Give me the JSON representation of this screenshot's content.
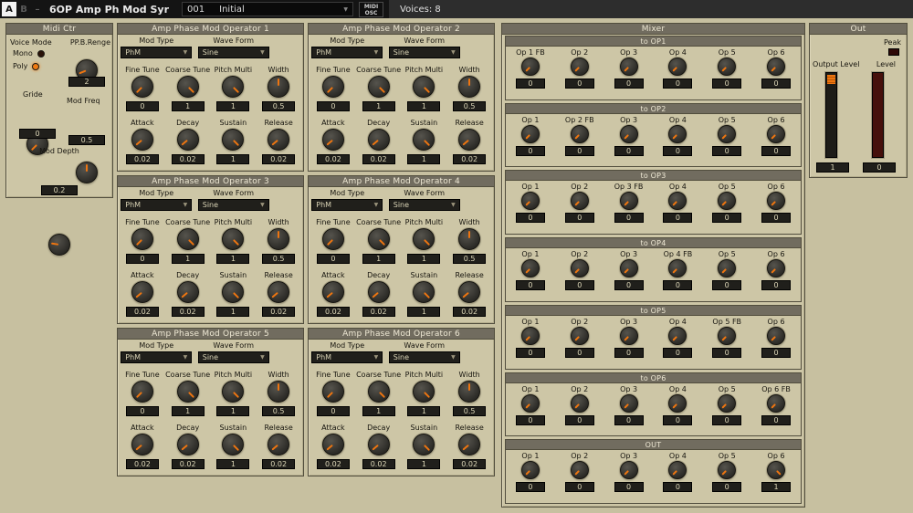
{
  "topbar": {
    "tab_a": "A",
    "tab_b": "B",
    "collapse": "–",
    "title": "6OP Amp Ph Mod Syr",
    "preset": {
      "number": "001",
      "name": "Initial"
    },
    "midi_button": {
      "line1": "MIDI",
      "line2": "OSC"
    },
    "voices": "Voices: 8"
  },
  "midi_ctr": {
    "title": "Midi Ctr",
    "voice_mode_label": "Voice Mode",
    "ppb_label": "PP.B.Renge",
    "mono_label": "Mono",
    "poly_label": "Poly",
    "ppb_value": "2",
    "gride_label": "Gride",
    "gride_value": "0",
    "mod_freq_label": "Mod Freq",
    "mod_freq_value": "0.5",
    "mod_depth_label": "Mod Depth",
    "mod_depth_value": "0.2"
  },
  "operators": [
    {
      "title": "Amp Phase Mod Operator 1",
      "mod_type_label": "Mod Type",
      "wave_form_label": "Wave Form",
      "mod_type": "PhM",
      "wave_form": "Sine",
      "tune_knobs": [
        {
          "label": "Fine Tune",
          "value": "0"
        },
        {
          "label": "Coarse Tune",
          "value": "1"
        },
        {
          "label": "Pitch Multi",
          "value": "1"
        },
        {
          "label": "Width",
          "value": "0.5"
        }
      ],
      "env_knobs": [
        {
          "label": "Attack",
          "value": "0.02"
        },
        {
          "label": "Decay",
          "value": "0.02"
        },
        {
          "label": "Sustain",
          "value": "1"
        },
        {
          "label": "Release",
          "value": "0.02"
        }
      ]
    },
    {
      "title": "Amp Phase Mod Operator 2",
      "mod_type_label": "Mod Type",
      "wave_form_label": "Wave Form",
      "mod_type": "PhM",
      "wave_form": "Sine",
      "tune_knobs": [
        {
          "label": "Fine Tune",
          "value": "0"
        },
        {
          "label": "Coarse Tune",
          "value": "1"
        },
        {
          "label": "Pitch Multi",
          "value": "1"
        },
        {
          "label": "Width",
          "value": "0.5"
        }
      ],
      "env_knobs": [
        {
          "label": "Attack",
          "value": "0.02"
        },
        {
          "label": "Decay",
          "value": "0.02"
        },
        {
          "label": "Sustain",
          "value": "1"
        },
        {
          "label": "Release",
          "value": "0.02"
        }
      ]
    },
    {
      "title": "Amp Phase Mod Operator 3",
      "mod_type_label": "Mod Type",
      "wave_form_label": "Wave Form",
      "mod_type": "PhM",
      "wave_form": "Sine",
      "tune_knobs": [
        {
          "label": "Fine Tune",
          "value": "0"
        },
        {
          "label": "Coarse Tune",
          "value": "1"
        },
        {
          "label": "Pitch Multi",
          "value": "1"
        },
        {
          "label": "Width",
          "value": "0.5"
        }
      ],
      "env_knobs": [
        {
          "label": "Attack",
          "value": "0.02"
        },
        {
          "label": "Decay",
          "value": "0.02"
        },
        {
          "label": "Sustain",
          "value": "1"
        },
        {
          "label": "Release",
          "value": "0.02"
        }
      ]
    },
    {
      "title": "Amp Phase Mod Operator 4",
      "mod_type_label": "Mod Type",
      "wave_form_label": "Wave Form",
      "mod_type": "PhM",
      "wave_form": "Sine",
      "tune_knobs": [
        {
          "label": "Fine Tune",
          "value": "0"
        },
        {
          "label": "Coarse Tune",
          "value": "1"
        },
        {
          "label": "Pitch Multi",
          "value": "1"
        },
        {
          "label": "Width",
          "value": "0.5"
        }
      ],
      "env_knobs": [
        {
          "label": "Attack",
          "value": "0.02"
        },
        {
          "label": "Decay",
          "value": "0.02"
        },
        {
          "label": "Sustain",
          "value": "1"
        },
        {
          "label": "Release",
          "value": "0.02"
        }
      ]
    },
    {
      "title": "Amp Phase Mod Operator 5",
      "mod_type_label": "Mod Type",
      "wave_form_label": "Wave Form",
      "mod_type": "PhM",
      "wave_form": "Sine",
      "tune_knobs": [
        {
          "label": "Fine Tune",
          "value": "0"
        },
        {
          "label": "Coarse Tune",
          "value": "1"
        },
        {
          "label": "Pitch Multi",
          "value": "1"
        },
        {
          "label": "Width",
          "value": "0.5"
        }
      ],
      "env_knobs": [
        {
          "label": "Attack",
          "value": "0.02"
        },
        {
          "label": "Decay",
          "value": "0.02"
        },
        {
          "label": "Sustain",
          "value": "1"
        },
        {
          "label": "Release",
          "value": "0.02"
        }
      ]
    },
    {
      "title": "Amp Phase Mod Operator 6",
      "mod_type_label": "Mod Type",
      "wave_form_label": "Wave Form",
      "mod_type": "PhM",
      "wave_form": "Sine",
      "tune_knobs": [
        {
          "label": "Fine Tune",
          "value": "0"
        },
        {
          "label": "Coarse Tune",
          "value": "1"
        },
        {
          "label": "Pitch Multi",
          "value": "1"
        },
        {
          "label": "Width",
          "value": "0.5"
        }
      ],
      "env_knobs": [
        {
          "label": "Attack",
          "value": "0.02"
        },
        {
          "label": "Decay",
          "value": "0.02"
        },
        {
          "label": "Sustain",
          "value": "1"
        },
        {
          "label": "Release",
          "value": "0.02"
        }
      ]
    }
  ],
  "mixer": {
    "title": "Mixer",
    "sections": [
      {
        "title": "to OP1",
        "knobs": [
          {
            "label": "Op 1 FB",
            "value": "0"
          },
          {
            "label": "Op 2",
            "value": "0"
          },
          {
            "label": "Op 3",
            "value": "0"
          },
          {
            "label": "Op 4",
            "value": "0"
          },
          {
            "label": "Op 5",
            "value": "0"
          },
          {
            "label": "Op 6",
            "value": "0"
          }
        ]
      },
      {
        "title": "to OP2",
        "knobs": [
          {
            "label": "Op 1",
            "value": "0"
          },
          {
            "label": "Op 2 FB",
            "value": "0"
          },
          {
            "label": "Op 3",
            "value": "0"
          },
          {
            "label": "Op 4",
            "value": "0"
          },
          {
            "label": "Op 5",
            "value": "0"
          },
          {
            "label": "Op 6",
            "value": "0"
          }
        ]
      },
      {
        "title": "to OP3",
        "knobs": [
          {
            "label": "Op 1",
            "value": "0"
          },
          {
            "label": "Op 2",
            "value": "0"
          },
          {
            "label": "Op 3 FB",
            "value": "0"
          },
          {
            "label": "Op 4",
            "value": "0"
          },
          {
            "label": "Op 5",
            "value": "0"
          },
          {
            "label": "Op 6",
            "value": "0"
          }
        ]
      },
      {
        "title": "to OP4",
        "knobs": [
          {
            "label": "Op 1",
            "value": "0"
          },
          {
            "label": "Op 2",
            "value": "0"
          },
          {
            "label": "Op 3",
            "value": "0"
          },
          {
            "label": "Op 4 FB",
            "value": "0"
          },
          {
            "label": "Op 5",
            "value": "0"
          },
          {
            "label": "Op 6",
            "value": "0"
          }
        ]
      },
      {
        "title": "to OP5",
        "knobs": [
          {
            "label": "Op 1",
            "value": "0"
          },
          {
            "label": "Op 2",
            "value": "0"
          },
          {
            "label": "Op 3",
            "value": "0"
          },
          {
            "label": "Op 4",
            "value": "0"
          },
          {
            "label": "Op 5 FB",
            "value": "0"
          },
          {
            "label": "Op 6",
            "value": "0"
          }
        ]
      },
      {
        "title": "to OP6",
        "knobs": [
          {
            "label": "Op 1",
            "value": "0"
          },
          {
            "label": "Op 2",
            "value": "0"
          },
          {
            "label": "Op 3",
            "value": "0"
          },
          {
            "label": "Op 4",
            "value": "0"
          },
          {
            "label": "Op 5",
            "value": "0"
          },
          {
            "label": "Op 6 FB",
            "value": "0"
          }
        ]
      },
      {
        "title": "OUT",
        "knobs": [
          {
            "label": "Op 1",
            "value": "0"
          },
          {
            "label": "Op 2",
            "value": "0"
          },
          {
            "label": "Op 3",
            "value": "0"
          },
          {
            "label": "Op 4",
            "value": "0"
          },
          {
            "label": "Op 5",
            "value": "0"
          },
          {
            "label": "Op 6",
            "value": "1"
          }
        ]
      }
    ]
  },
  "out": {
    "title": "Out",
    "peak_label": "Peak",
    "output_level_label": "Output Level",
    "level_label": "Level",
    "output_level_value": "1",
    "level_value": "0"
  }
}
